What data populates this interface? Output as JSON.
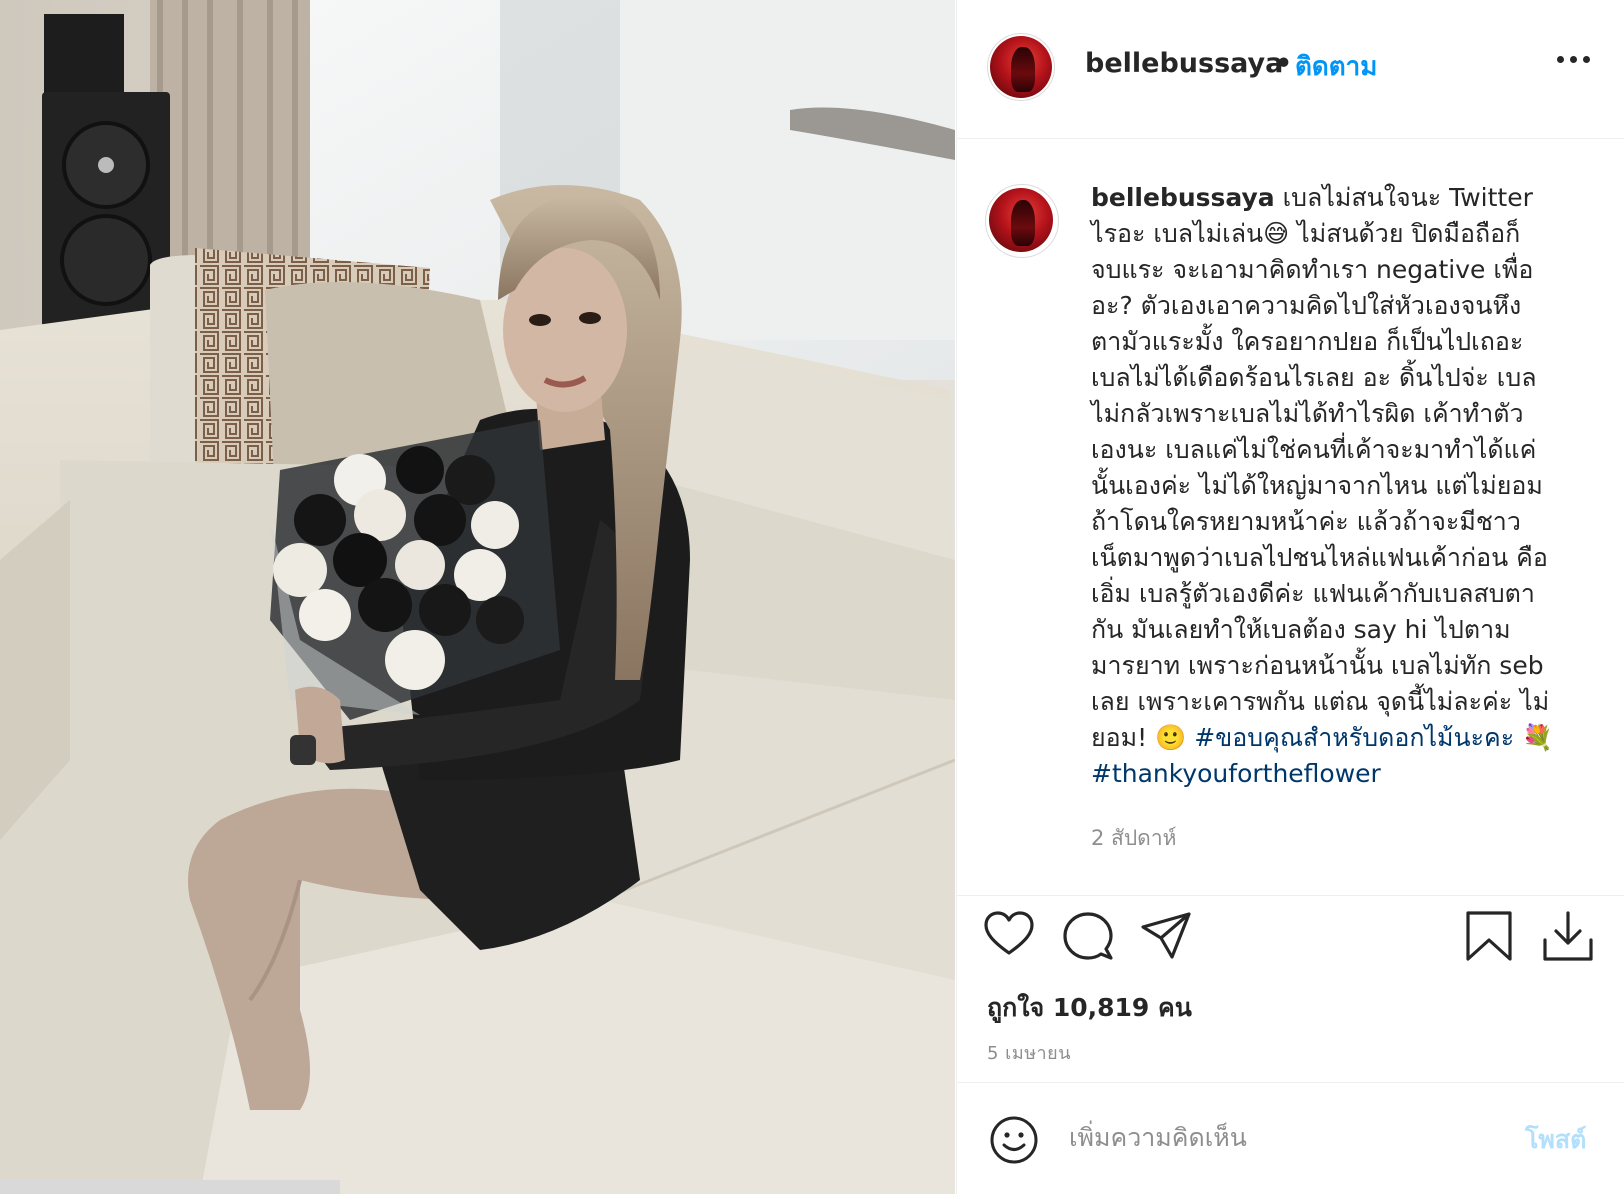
{
  "header": {
    "username": "bellebussaya",
    "separator": "•",
    "follow_label": "ติดตาม"
  },
  "caption": {
    "username": "bellebussaya",
    "lines": [
      "เบลไม่สนใจนะ Twitter",
      "ไรอะ เบลไม่เล่น😅 ไม่สนด้วย ปิดมือถือก็",
      "จบแระ จะเอามาคิดทำเรา negative เพื่อ",
      "อะ? ตัวเองเอาความคิดไปใส่หัวเองจนหึง",
      "ตามัวแระมั้ง ใครอยากปยอ ก็เป็นไปเถอะ",
      "เบลไม่ได้เดือดร้อนไรเลย อะ ดิ้นไปจ่ะ เบล",
      "ไม่กลัวเพราะเบลไม่ได้ทำไรผิด เค้าทำตัว",
      "เองนะ เบลแค่ไม่ใช่คนที่เค้าจะมาทำได้แค่",
      "นั้นเองค่ะ ไม่ได้ใหญ่มาจากไหน แต่ไม่ยอม",
      "ถ้าโดนใครหยามหน้าค่ะ แล้วถ้าจะมีชาว",
      "เน็ตมาพูดว่าเบลไปชนไหล่แฟนเค้าก่อน คือ",
      "เอิ่ม เบลรู้ตัวเองดีค่ะ แฟนเค้ากับเบลสบตา",
      "กัน มันเลยทำให้เบลต้อง say hi ไปตาม",
      "มารยาท เพราะก่อนหน้านั้น เบลไม่ทัก seb",
      "เลย เพราะเคารพกัน แต่ณ จุดนี้ไม่ละค่ะ ไม่"
    ],
    "last_line_text": "ยอม! 🙂 ",
    "hashtag_1": "#ขอบคุณสำหรับดอกไม้นะคะ",
    "hashtag_1_suffix": " 💐",
    "hashtag_2": "#thankyoufortheflower",
    "time_ago": "2 สัปดาห์"
  },
  "actions": {
    "like_icon": "heart-icon",
    "comment_icon": "comment-icon",
    "share_icon": "paper-plane-icon",
    "save_icon": "bookmark-icon",
    "download_icon": "download-icon"
  },
  "likes_text": "ถูกใจ 10,819 คน",
  "date_text": "5 เมษายน",
  "comment": {
    "placeholder": "เพิ่มความคิดเห็น",
    "post_label": "โพสต์",
    "emoji_icon": "smiley-icon"
  },
  "colors": {
    "accent": "#0095f6",
    "hashtag": "#00376b",
    "muted": "#8e8e8e",
    "post_disabled": "#b2dffc"
  }
}
